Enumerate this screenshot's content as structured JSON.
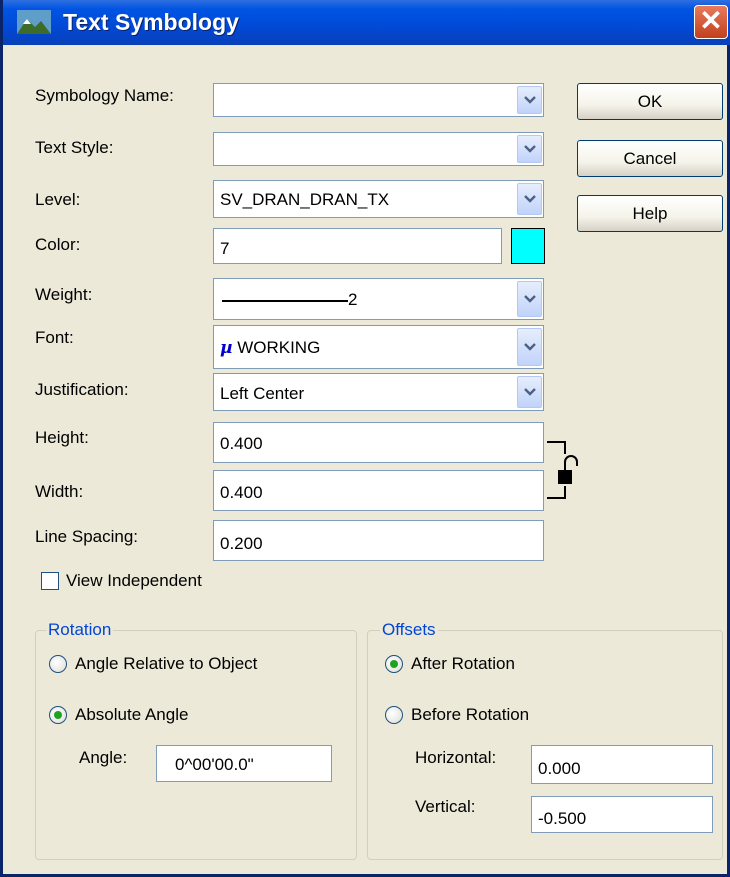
{
  "window": {
    "title": "Text Symbology"
  },
  "fields": {
    "symbology_name": {
      "label": "Symbology Name:",
      "value": ""
    },
    "text_style": {
      "label": "Text Style:",
      "value": ""
    },
    "level": {
      "label": "Level:",
      "value": "SV_DRAN_DRAN_TX"
    },
    "color": {
      "label": "Color:",
      "value": "7",
      "swatch": "#00ffff"
    },
    "weight": {
      "label": "Weight:",
      "value": "2"
    },
    "font": {
      "label": "Font:",
      "value": "WORKING"
    },
    "justification": {
      "label": "Justification:",
      "value": "Left Center"
    },
    "height": {
      "label": "Height:",
      "value": "0.400"
    },
    "width": {
      "label": "Width:",
      "value": "0.400"
    },
    "line_spacing": {
      "label": "Line Spacing:",
      "value": "0.200"
    }
  },
  "view_independent": {
    "label": "View Independent",
    "checked": false
  },
  "buttons": {
    "ok": "OK",
    "cancel": "Cancel",
    "help": "Help"
  },
  "rotation": {
    "title": "Rotation",
    "angle_relative": {
      "label": "Angle Relative to Object",
      "selected": false
    },
    "absolute_angle": {
      "label": "Absolute Angle",
      "selected": true
    },
    "angle_label": "Angle:",
    "angle_value": "0^00'00.0\""
  },
  "offsets": {
    "title": "Offsets",
    "after_rotation": {
      "label": "After Rotation",
      "selected": true
    },
    "before_rotation": {
      "label": "Before Rotation",
      "selected": false
    },
    "horizontal_label": "Horizontal:",
    "horizontal_value": "0.000",
    "vertical_label": "Vertical:",
    "vertical_value": "-0.500"
  },
  "colors": {
    "title_bar": "#0054e3",
    "accent": "#0046d5",
    "color_swatch": "#00ffff"
  }
}
